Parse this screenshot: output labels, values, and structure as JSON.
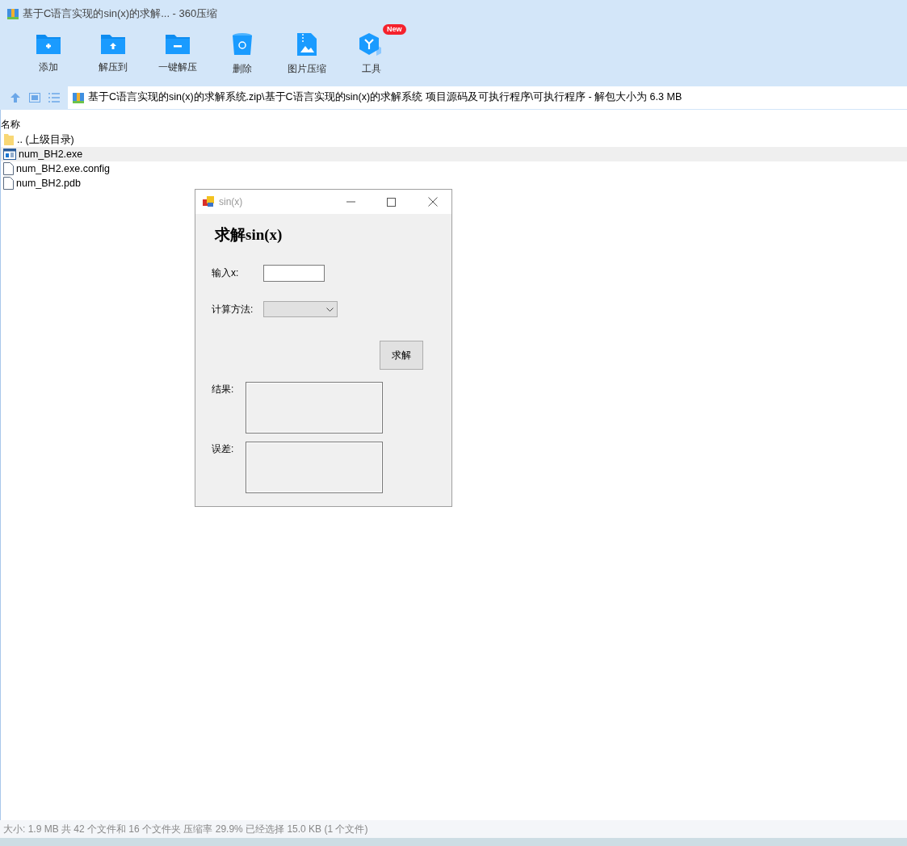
{
  "window": {
    "title": "基于C语言实现的sin(x)的求解... - 360压缩"
  },
  "toolbar": [
    {
      "kind": "add",
      "label": "添加"
    },
    {
      "kind": "extract",
      "label": "解压到"
    },
    {
      "kind": "oneclick",
      "label": "一键解压"
    },
    {
      "kind": "delete",
      "label": "删除"
    },
    {
      "kind": "image",
      "label": "图片压缩"
    },
    {
      "kind": "tools",
      "label": "工具",
      "badge": "New"
    }
  ],
  "address": {
    "path": "基于C语言实现的sin(x)的求解系统.zip\\基于C语言实现的sin(x)的求解系统 项目源码及可执行程序\\可执行程序 - 解包大小为 6.3 MB"
  },
  "file_list": {
    "columns": [
      "名称"
    ],
    "rows": [
      {
        "kind": "folder",
        "name": ".. (上级目录)",
        "selected": false
      },
      {
        "kind": "exe",
        "name": "num_BH2.exe",
        "selected": true
      },
      {
        "kind": "file",
        "name": "num_BH2.exe.config",
        "selected": false
      },
      {
        "kind": "file",
        "name": "num_BH2.pdb",
        "selected": false
      }
    ]
  },
  "dialog": {
    "title": "sin(x)",
    "heading": "求解sin(x)",
    "fields": [
      {
        "kind": "text",
        "label": "输入x:"
      },
      {
        "kind": "select",
        "label": "计算方法:"
      }
    ],
    "button": "求解",
    "outputs": [
      {
        "label": "结果:"
      },
      {
        "label": "误差:"
      }
    ]
  },
  "status_bar": "大小: 1.9 MB 共 42 个文件和 16 个文件夹 压缩率 29.9% 已经选择 15.0 KB (1 个文件)"
}
